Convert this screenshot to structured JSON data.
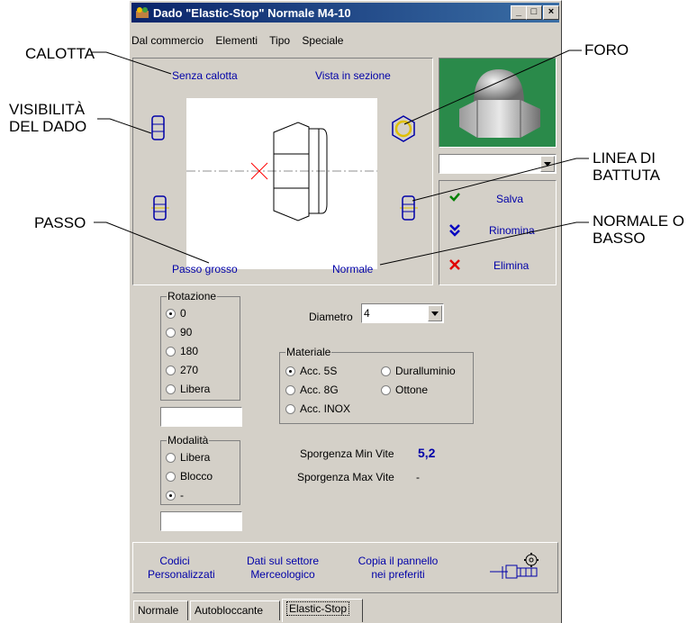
{
  "window": {
    "title": "Dado \"Elastic-Stop\" Normale M4-10",
    "controls": {
      "minimize": "_",
      "maximize": "□",
      "close": "×"
    }
  },
  "menu": [
    "Dal commercio",
    "Elementi",
    "Tipo",
    "Speciale"
  ],
  "preview": {
    "top_left": "Senza calotta",
    "top_right": "Vista in sezione",
    "bottom_left": "Passo grosso",
    "bottom_right": "Normale"
  },
  "actions": {
    "save": "Salva",
    "rename": "Rinomina",
    "delete": "Elimina"
  },
  "callouts": {
    "calotta": "CALOTTA",
    "foro": "FORO",
    "visibilita": "VISIBILITÀ\nDEL DADO",
    "linea": "LINEA DI\nBATTUTA",
    "passo": "PASSO",
    "normale": "NORMALE O\nBASSO"
  },
  "rotazione": {
    "legend": "Rotazione",
    "options": [
      "0",
      "90",
      "180",
      "270",
      "Libera"
    ],
    "selected": "0"
  },
  "modalita": {
    "legend": "Modalità",
    "options": [
      "Libera",
      "Blocco",
      "-"
    ],
    "selected": "-"
  },
  "diametro": {
    "label": "Diametro",
    "value": "4"
  },
  "materiale": {
    "legend": "Materiale",
    "options": [
      "Acc. 5S",
      "Duralluminio",
      "Acc. 8G",
      "Ottone",
      "Acc. INOX"
    ],
    "selected": "Acc. 5S"
  },
  "sporgenza": {
    "min_label": "Sporgenza Min Vite",
    "min_value": "5,2",
    "max_label": "Sporgenza Max Vite",
    "max_value": "-"
  },
  "bottom_buttons": {
    "codici": "Codici\nPersonalizzati",
    "dati": "Dati sul settore\nMerceologico",
    "copia": "Copia il pannello\nnei preferiti"
  },
  "tabs": [
    "Normale",
    "Autobloccante",
    "Elastic-Stop"
  ],
  "active_tab": "Elastic-Stop",
  "colors": {
    "accent_blue": "#0000a8",
    "titlebar": "#0a246a",
    "delete_red": "#e00000",
    "check_green": "#008000"
  }
}
